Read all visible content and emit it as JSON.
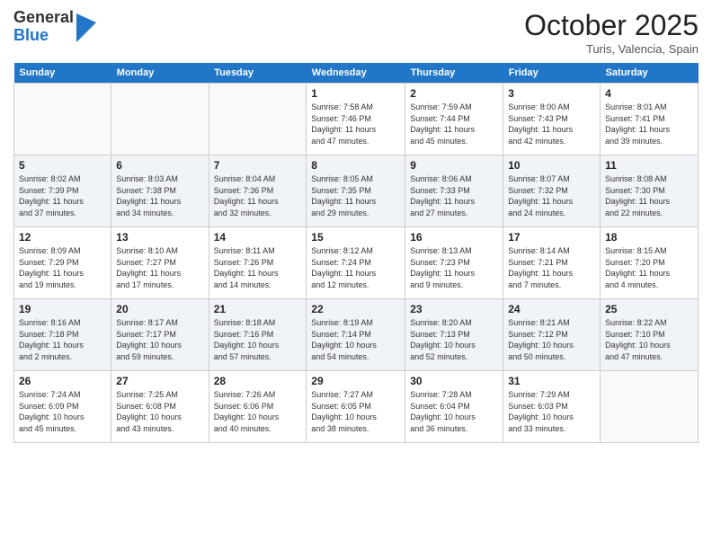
{
  "header": {
    "logo_general": "General",
    "logo_blue": "Blue",
    "month_title": "October 2025",
    "location": "Turis, Valencia, Spain"
  },
  "days_of_week": [
    "Sunday",
    "Monday",
    "Tuesday",
    "Wednesday",
    "Thursday",
    "Friday",
    "Saturday"
  ],
  "weeks": [
    [
      {
        "day": "",
        "info": ""
      },
      {
        "day": "",
        "info": ""
      },
      {
        "day": "",
        "info": ""
      },
      {
        "day": "1",
        "info": "Sunrise: 7:58 AM\nSunset: 7:46 PM\nDaylight: 11 hours\nand 47 minutes."
      },
      {
        "day": "2",
        "info": "Sunrise: 7:59 AM\nSunset: 7:44 PM\nDaylight: 11 hours\nand 45 minutes."
      },
      {
        "day": "3",
        "info": "Sunrise: 8:00 AM\nSunset: 7:43 PM\nDaylight: 11 hours\nand 42 minutes."
      },
      {
        "day": "4",
        "info": "Sunrise: 8:01 AM\nSunset: 7:41 PM\nDaylight: 11 hours\nand 39 minutes."
      }
    ],
    [
      {
        "day": "5",
        "info": "Sunrise: 8:02 AM\nSunset: 7:39 PM\nDaylight: 11 hours\nand 37 minutes."
      },
      {
        "day": "6",
        "info": "Sunrise: 8:03 AM\nSunset: 7:38 PM\nDaylight: 11 hours\nand 34 minutes."
      },
      {
        "day": "7",
        "info": "Sunrise: 8:04 AM\nSunset: 7:36 PM\nDaylight: 11 hours\nand 32 minutes."
      },
      {
        "day": "8",
        "info": "Sunrise: 8:05 AM\nSunset: 7:35 PM\nDaylight: 11 hours\nand 29 minutes."
      },
      {
        "day": "9",
        "info": "Sunrise: 8:06 AM\nSunset: 7:33 PM\nDaylight: 11 hours\nand 27 minutes."
      },
      {
        "day": "10",
        "info": "Sunrise: 8:07 AM\nSunset: 7:32 PM\nDaylight: 11 hours\nand 24 minutes."
      },
      {
        "day": "11",
        "info": "Sunrise: 8:08 AM\nSunset: 7:30 PM\nDaylight: 11 hours\nand 22 minutes."
      }
    ],
    [
      {
        "day": "12",
        "info": "Sunrise: 8:09 AM\nSunset: 7:29 PM\nDaylight: 11 hours\nand 19 minutes."
      },
      {
        "day": "13",
        "info": "Sunrise: 8:10 AM\nSunset: 7:27 PM\nDaylight: 11 hours\nand 17 minutes."
      },
      {
        "day": "14",
        "info": "Sunrise: 8:11 AM\nSunset: 7:26 PM\nDaylight: 11 hours\nand 14 minutes."
      },
      {
        "day": "15",
        "info": "Sunrise: 8:12 AM\nSunset: 7:24 PM\nDaylight: 11 hours\nand 12 minutes."
      },
      {
        "day": "16",
        "info": "Sunrise: 8:13 AM\nSunset: 7:23 PM\nDaylight: 11 hours\nand 9 minutes."
      },
      {
        "day": "17",
        "info": "Sunrise: 8:14 AM\nSunset: 7:21 PM\nDaylight: 11 hours\nand 7 minutes."
      },
      {
        "day": "18",
        "info": "Sunrise: 8:15 AM\nSunset: 7:20 PM\nDaylight: 11 hours\nand 4 minutes."
      }
    ],
    [
      {
        "day": "19",
        "info": "Sunrise: 8:16 AM\nSunset: 7:18 PM\nDaylight: 11 hours\nand 2 minutes."
      },
      {
        "day": "20",
        "info": "Sunrise: 8:17 AM\nSunset: 7:17 PM\nDaylight: 10 hours\nand 59 minutes."
      },
      {
        "day": "21",
        "info": "Sunrise: 8:18 AM\nSunset: 7:16 PM\nDaylight: 10 hours\nand 57 minutes."
      },
      {
        "day": "22",
        "info": "Sunrise: 8:19 AM\nSunset: 7:14 PM\nDaylight: 10 hours\nand 54 minutes."
      },
      {
        "day": "23",
        "info": "Sunrise: 8:20 AM\nSunset: 7:13 PM\nDaylight: 10 hours\nand 52 minutes."
      },
      {
        "day": "24",
        "info": "Sunrise: 8:21 AM\nSunset: 7:12 PM\nDaylight: 10 hours\nand 50 minutes."
      },
      {
        "day": "25",
        "info": "Sunrise: 8:22 AM\nSunset: 7:10 PM\nDaylight: 10 hours\nand 47 minutes."
      }
    ],
    [
      {
        "day": "26",
        "info": "Sunrise: 7:24 AM\nSunset: 6:09 PM\nDaylight: 10 hours\nand 45 minutes."
      },
      {
        "day": "27",
        "info": "Sunrise: 7:25 AM\nSunset: 6:08 PM\nDaylight: 10 hours\nand 43 minutes."
      },
      {
        "day": "28",
        "info": "Sunrise: 7:26 AM\nSunset: 6:06 PM\nDaylight: 10 hours\nand 40 minutes."
      },
      {
        "day": "29",
        "info": "Sunrise: 7:27 AM\nSunset: 6:05 PM\nDaylight: 10 hours\nand 38 minutes."
      },
      {
        "day": "30",
        "info": "Sunrise: 7:28 AM\nSunset: 6:04 PM\nDaylight: 10 hours\nand 36 minutes."
      },
      {
        "day": "31",
        "info": "Sunrise: 7:29 AM\nSunset: 6:03 PM\nDaylight: 10 hours\nand 33 minutes."
      },
      {
        "day": "",
        "info": ""
      }
    ]
  ]
}
